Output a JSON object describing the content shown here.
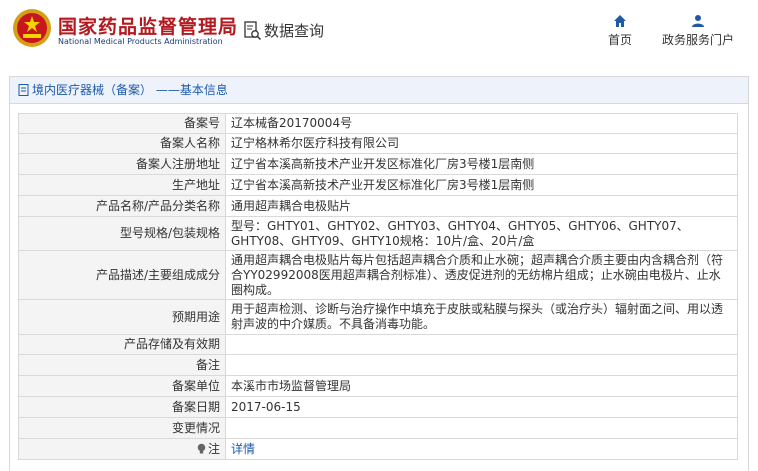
{
  "header": {
    "logo_cn": "国家药品监督管理局",
    "logo_en": "National Medical Products Administration",
    "query_label": "数据查询",
    "nav": [
      {
        "label": "首页",
        "icon": "home-icon"
      },
      {
        "label": "政务服务门户",
        "icon": "user-icon"
      }
    ]
  },
  "breadcrumb": "境内医疗器械（备案） ——基本信息",
  "rows": [
    {
      "label": "备案号",
      "value": "辽本械备20170004号"
    },
    {
      "label": "备案人名称",
      "value": "辽宁格林希尔医疗科技有限公司"
    },
    {
      "label": "备案人注册地址",
      "value": "辽宁省本溪高新技术产业开发区标准化厂房3号楼1层南侧"
    },
    {
      "label": "生产地址",
      "value": "辽宁省本溪高新技术产业开发区标准化厂房3号楼1层南侧"
    },
    {
      "label": "产品名称/产品分类名称",
      "value": "通用超声耦合电极贴片"
    },
    {
      "label": "型号规格/包装规格",
      "value": "型号：GHTY01、GHTY02、GHTY03、GHTY04、GHTY05、GHTY06、GHTY07、GHTY08、GHTY09、GHTY10规格：10片/盒、20片/盒"
    },
    {
      "label": "产品描述/主要组成成分",
      "value": "通用超声耦合电极贴片每片包括超声耦合介质和止水碗；超声耦合介质主要由内含耦合剂（符合YY02992008医用超声耦合剂标准）、透皮促进剂的无纺棉片组成；止水碗由电极片、止水圈构成。"
    },
    {
      "label": "预期用途",
      "value": "用于超声检测、诊断与治疗操作中填充于皮肤或粘膜与探头（或治疗头）辐射面之间、用以透射声波的中介媒质。不具备消毒功能。"
    },
    {
      "label": "产品存储及有效期",
      "value": ""
    },
    {
      "label": "备注",
      "value": ""
    },
    {
      "label": "备案单位",
      "value": "本溪市市场监督管理局"
    },
    {
      "label": "备案日期",
      "value": "2017-06-15"
    },
    {
      "label": "变更情况",
      "value": ""
    },
    {
      "label": "注",
      "value": "详情"
    }
  ],
  "colors": {
    "brand_red": "#b3191f",
    "brand_blue": "#1e5aa8"
  }
}
